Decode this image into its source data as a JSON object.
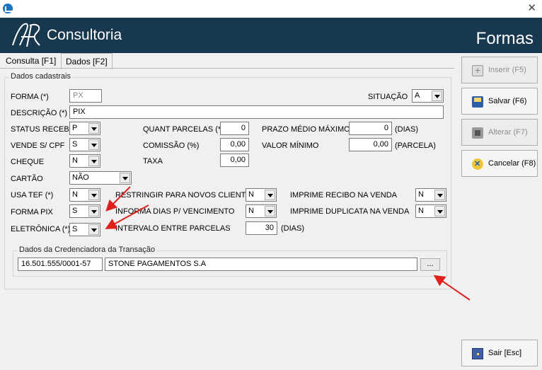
{
  "window": {
    "header_brand": "Consultoria",
    "header_title": "Formas"
  },
  "tabs": [
    {
      "label": "Consulta [F1]"
    },
    {
      "label": "Dados [F2]"
    }
  ],
  "group_cadastrais": {
    "legend": "Dados cadastrais"
  },
  "forma": {
    "label": "FORMA (*)",
    "value": "PX"
  },
  "situacao": {
    "label": "SITUAÇÃO",
    "value": "A"
  },
  "descricao": {
    "label": "DESCRIÇÃO (*)",
    "value": "PIX"
  },
  "status_receb": {
    "label": "STATUS RECEB.",
    "value": "P"
  },
  "quant_parcelas": {
    "label": "QUANT PARCELAS (*)",
    "value": "0"
  },
  "prazo_medio": {
    "label": "PRAZO MÉDIO MÁXIMO",
    "value": "0",
    "unit": "(DIAS)"
  },
  "vende_cpf": {
    "label": "VENDE S/ CPF",
    "value": "S"
  },
  "comissao": {
    "label": "COMISSÃO (%)",
    "value": "0,00"
  },
  "valor_minimo": {
    "label": "VALOR MÍNIMO",
    "value": "0,00",
    "unit": "(PARCELA)"
  },
  "cheque": {
    "label": "CHEQUE",
    "value": "N"
  },
  "taxa": {
    "label": "TAXA",
    "value": "0,00"
  },
  "cartao": {
    "label": "CARTÃO",
    "value": "NÃO"
  },
  "usa_tef": {
    "label": "USA TEF (*)",
    "value": "N"
  },
  "restringir": {
    "label": "RESTRINGIR PARA NOVOS CLIENTES",
    "value": "N"
  },
  "imprime_recibo": {
    "label": "IMPRIME RECIBO NA VENDA",
    "value": "N"
  },
  "forma_pix": {
    "label": "FORMA PIX",
    "value": "S"
  },
  "informa_dias": {
    "label": "INFORMA DIAS P/ VENCIMENTO",
    "value": "N"
  },
  "imprime_duplicata": {
    "label": "IMPRIME DUPLICATA NA VENDA",
    "value": "N"
  },
  "eletronica": {
    "label": "ELETRÔNICA (*)",
    "value": "S"
  },
  "intervalo": {
    "label": "INTERVALO ENTRE PARCELAS",
    "value": "30",
    "unit": "(DIAS)"
  },
  "credenciadora": {
    "legend": "Dados da Credenciadora da Transação",
    "cnpj": "16.501.555/0001-57",
    "nome": "STONE PAGAMENTOS S.A",
    "lookup_label": "..."
  },
  "buttons": {
    "inserir": "Inserir (F5)",
    "salvar": "Salvar (F6)",
    "alterar": "Alterar (F7)",
    "cancelar": "Cancelar (F8)",
    "sair": "Sair [Esc]"
  },
  "colors": {
    "header_bg": "#17384f",
    "annotation_arrow": "#e0201c"
  },
  "icons": {
    "app": "app-icon",
    "close": "close-icon",
    "logo": "logo-icon",
    "inserir": "insert-icon",
    "salvar": "save-disk-icon",
    "alterar": "edit-icon",
    "cancelar": "cancel-icon",
    "sair": "exit-door-icon"
  }
}
